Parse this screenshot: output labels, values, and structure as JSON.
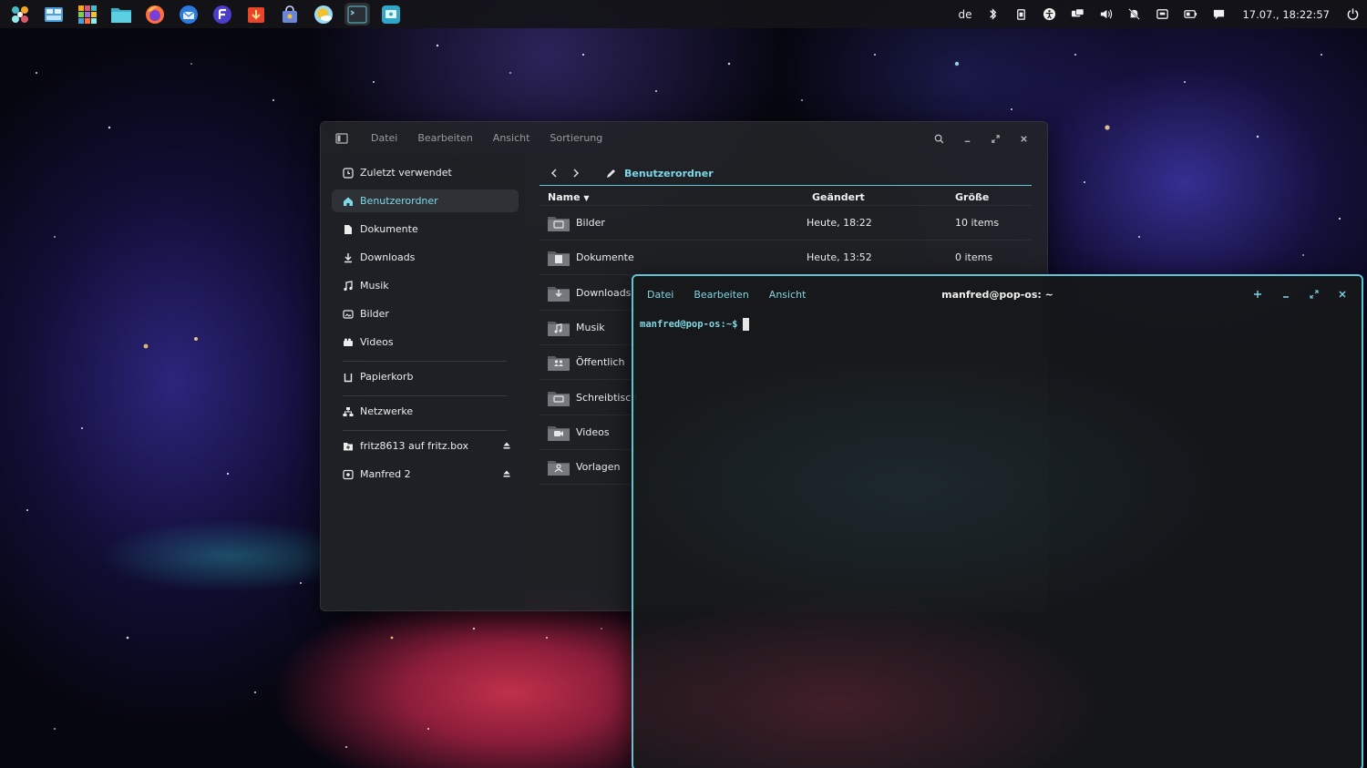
{
  "topbar": {
    "dock_apps": [
      {
        "name": "pop-launcher",
        "color": "#48b9c7"
      },
      {
        "name": "workspaces",
        "color": "#4a9fdc"
      },
      {
        "name": "app-grid",
        "color": "#f6a623"
      },
      {
        "name": "files",
        "color": "#3ab0c8"
      },
      {
        "name": "firefox",
        "color": "#ff7139"
      },
      {
        "name": "thunderbird",
        "color": "#2a7bde"
      },
      {
        "name": "fedora-app",
        "color": "#4b3cc9"
      },
      {
        "name": "downloader",
        "color": "#e8452a"
      },
      {
        "name": "software-center",
        "color": "#6b86d6"
      },
      {
        "name": "weather",
        "color": "#f2c230"
      },
      {
        "name": "terminal",
        "color": "#2a2f36"
      },
      {
        "name": "remote-desktop",
        "color": "#2fa7c9"
      }
    ],
    "keyboard_layout": "de",
    "clock": "17.07., 18:22:57"
  },
  "file_manager": {
    "menu": [
      "Datei",
      "Bearbeiten",
      "Ansicht",
      "Sortierung"
    ],
    "sidebar": [
      {
        "label": "Zuletzt verwendet",
        "icon": "recent-icon"
      },
      {
        "label": "Benutzerordner",
        "icon": "home-icon",
        "active": true
      },
      {
        "label": "Dokumente",
        "icon": "document-icon"
      },
      {
        "label": "Downloads",
        "icon": "download-icon"
      },
      {
        "label": "Musik",
        "icon": "music-icon"
      },
      {
        "label": "Bilder",
        "icon": "image-icon"
      },
      {
        "label": "Videos",
        "icon": "video-icon"
      },
      {
        "label": "Papierkorb",
        "icon": "trash-icon"
      },
      {
        "label": "Netzwerke",
        "icon": "network-icon"
      },
      {
        "label": "fritz8613 auf fritz.box",
        "icon": "network-share-icon",
        "eject": true
      },
      {
        "label": "Manfred 2",
        "icon": "drive-icon",
        "eject": true
      }
    ],
    "path": "Benutzerordner",
    "columns": {
      "name": "Name",
      "modified": "Geändert",
      "size": "Größe"
    },
    "rows": [
      {
        "name": "Bilder",
        "modified": "Heute, 18:22",
        "size": "10 items",
        "icon": "folder-pictures-icon"
      },
      {
        "name": "Dokumente",
        "modified": "Heute, 13:52",
        "size": "0 items",
        "icon": "folder-documents-icon"
      },
      {
        "name": "Downloads",
        "modified": "",
        "size": "",
        "icon": "folder-download-icon"
      },
      {
        "name": "Musik",
        "modified": "",
        "size": "",
        "icon": "folder-music-icon"
      },
      {
        "name": "Öffentlich",
        "modified": "",
        "size": "",
        "icon": "folder-public-icon"
      },
      {
        "name": "Schreibtisch",
        "modified": "",
        "size": "",
        "icon": "folder-desktop-icon"
      },
      {
        "name": "Videos",
        "modified": "",
        "size": "",
        "icon": "folder-videos-icon"
      },
      {
        "name": "Vorlagen",
        "modified": "",
        "size": "",
        "icon": "folder-templates-icon"
      }
    ]
  },
  "terminal": {
    "menu": [
      "Datei",
      "Bearbeiten",
      "Ansicht"
    ],
    "title": "manfred@pop-os: ~",
    "prompt": "manfred@pop-os:~$"
  },
  "colors": {
    "accent": "#5fc4d4",
    "accent_text": "#7fd8e6"
  }
}
